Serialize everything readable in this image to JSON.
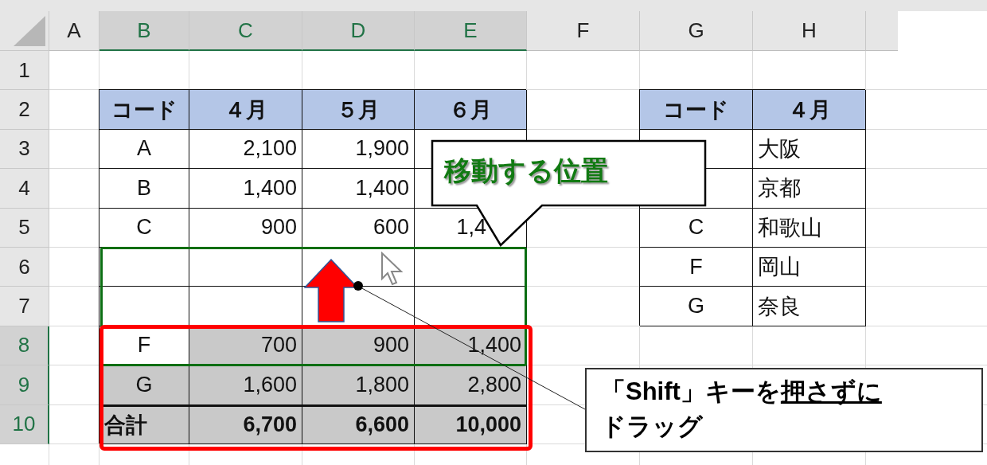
{
  "sheet": {
    "columns": [
      {
        "label": "A",
        "selected": false
      },
      {
        "label": "B",
        "selected": true
      },
      {
        "label": "C",
        "selected": true
      },
      {
        "label": "D",
        "selected": true
      },
      {
        "label": "E",
        "selected": true
      },
      {
        "label": "F",
        "selected": false
      },
      {
        "label": "G",
        "selected": false
      },
      {
        "label": "H",
        "selected": false
      }
    ],
    "rows": [
      {
        "number": "1",
        "selected": false,
        "cells": [
          {
            "kind": "blank"
          },
          {
            "kind": "blank"
          },
          {
            "kind": "blank"
          },
          {
            "kind": "blank"
          },
          {
            "kind": "blank"
          },
          {
            "kind": "blank"
          },
          {
            "kind": "blank"
          },
          {
            "kind": "blank"
          }
        ]
      },
      {
        "number": "2",
        "selected": false,
        "cells": [
          {
            "kind": "blank"
          },
          {
            "kind": "header",
            "text": "コード",
            "selected": false
          },
          {
            "kind": "header",
            "text": "４月",
            "selected": false
          },
          {
            "kind": "header",
            "text": "５月",
            "selected": false
          },
          {
            "kind": "header",
            "text": "６月",
            "selected": false
          },
          {
            "kind": "blank"
          },
          {
            "kind": "header",
            "text": "コード",
            "selected": false
          },
          {
            "kind": "header",
            "text": "４月",
            "selected": false
          }
        ]
      },
      {
        "number": "3",
        "selected": false,
        "cells": [
          {
            "kind": "blank"
          },
          {
            "kind": "code",
            "text": "A",
            "selected": false
          },
          {
            "kind": "number",
            "text": "2,100",
            "selected": false
          },
          {
            "kind": "number",
            "text": "1,900",
            "selected": false
          },
          {
            "kind": "empty",
            "selected": false
          },
          {
            "kind": "blank"
          },
          {
            "kind": "empty",
            "selected": false
          },
          {
            "kind": "name",
            "text": "大阪",
            "selected": false
          }
        ]
      },
      {
        "number": "4",
        "selected": false,
        "cells": [
          {
            "kind": "blank"
          },
          {
            "kind": "code",
            "text": "B",
            "selected": false
          },
          {
            "kind": "number",
            "text": "1,400",
            "selected": false
          },
          {
            "kind": "number",
            "text": "1,400",
            "selected": false
          },
          {
            "kind": "empty",
            "selected": false
          },
          {
            "kind": "blank"
          },
          {
            "kind": "empty",
            "selected": false
          },
          {
            "kind": "name",
            "text": "京都",
            "selected": false
          }
        ]
      },
      {
        "number": "5",
        "selected": false,
        "cells": [
          {
            "kind": "blank"
          },
          {
            "kind": "code",
            "text": "C",
            "selected": false
          },
          {
            "kind": "number",
            "text": "900",
            "selected": false
          },
          {
            "kind": "number",
            "text": "600",
            "selected": false
          },
          {
            "kind": "partial-number",
            "text": "1,4",
            "selected": false
          },
          {
            "kind": "blank"
          },
          {
            "kind": "code",
            "text": "C",
            "selected": false
          },
          {
            "kind": "name",
            "text": "和歌山",
            "selected": false
          }
        ]
      },
      {
        "number": "6",
        "selected": false,
        "cells": [
          {
            "kind": "blank"
          },
          {
            "kind": "empty",
            "selected": false
          },
          {
            "kind": "empty",
            "selected": false
          },
          {
            "kind": "empty",
            "selected": false
          },
          {
            "kind": "empty",
            "selected": false
          },
          {
            "kind": "blank"
          },
          {
            "kind": "code",
            "text": "F",
            "selected": false
          },
          {
            "kind": "name",
            "text": "岡山",
            "selected": false
          }
        ]
      },
      {
        "number": "7",
        "selected": false,
        "cells": [
          {
            "kind": "blank"
          },
          {
            "kind": "empty",
            "selected": false
          },
          {
            "kind": "empty",
            "selected": false
          },
          {
            "kind": "empty",
            "selected": false
          },
          {
            "kind": "empty",
            "selected": false
          },
          {
            "kind": "blank"
          },
          {
            "kind": "code",
            "text": "G",
            "selected": false
          },
          {
            "kind": "name",
            "text": "奈良",
            "selected": false
          }
        ]
      },
      {
        "number": "8",
        "selected": true,
        "cells": [
          {
            "kind": "blank"
          },
          {
            "kind": "code",
            "text": "F",
            "selected": false
          },
          {
            "kind": "number",
            "text": "700",
            "selected": true
          },
          {
            "kind": "number",
            "text": "900",
            "selected": true
          },
          {
            "kind": "number",
            "text": "1,400",
            "selected": true
          },
          {
            "kind": "blank"
          },
          {
            "kind": "blank"
          },
          {
            "kind": "blank"
          }
        ]
      },
      {
        "number": "9",
        "selected": true,
        "cells": [
          {
            "kind": "blank"
          },
          {
            "kind": "code",
            "text": "G",
            "selected": true
          },
          {
            "kind": "number",
            "text": "1,600",
            "selected": true
          },
          {
            "kind": "number",
            "text": "1,800",
            "selected": true
          },
          {
            "kind": "number",
            "text": "2,800",
            "selected": true
          },
          {
            "kind": "blank"
          },
          {
            "kind": "blank"
          },
          {
            "kind": "blank"
          }
        ]
      },
      {
        "number": "10",
        "selected": true,
        "cells": [
          {
            "kind": "blank"
          },
          {
            "kind": "total-label",
            "text": "合計",
            "selected": true
          },
          {
            "kind": "total",
            "text": "6,700",
            "selected": true
          },
          {
            "kind": "total",
            "text": "6,600",
            "selected": true
          },
          {
            "kind": "total",
            "text": "10,000",
            "selected": true
          },
          {
            "kind": "blank"
          },
          {
            "kind": "blank"
          },
          {
            "kind": "blank"
          }
        ]
      }
    ]
  },
  "callout": {
    "text": "移動する位置"
  },
  "note": {
    "lines": [
      [
        {
          "text": "「Shift」キーを",
          "underline": false
        },
        {
          "text": "押さずに",
          "underline": true
        }
      ],
      [
        {
          "text": "ドラッグ",
          "underline": false
        }
      ]
    ]
  }
}
